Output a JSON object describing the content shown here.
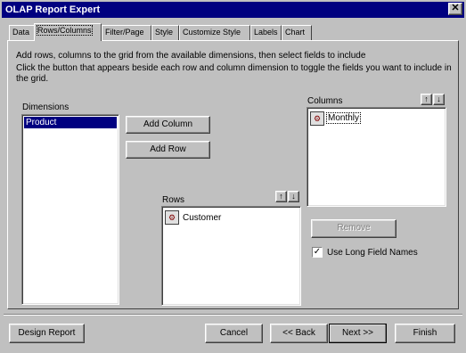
{
  "window": {
    "title": "OLAP Report Expert",
    "close_glyph": "✕"
  },
  "tabs": [
    {
      "label": "Data"
    },
    {
      "label": "Rows/Columns"
    },
    {
      "label": "Filter/Page"
    },
    {
      "label": "Style"
    },
    {
      "label": "Customize Style"
    },
    {
      "label": "Labels"
    },
    {
      "label": "Chart"
    }
  ],
  "instructions": {
    "line1": "Add rows, columns to the grid from the available dimensions, then select fields to include",
    "line2": "Click the button that appears beside each row and column dimension to toggle the fields you want to include in",
    "line3": "the grid."
  },
  "dimensions": {
    "label": "Dimensions",
    "items": [
      "Product"
    ]
  },
  "buttons": {
    "add_column": "Add Column",
    "add_row": "Add Row",
    "remove": "Remove",
    "design_report": "Design Report",
    "cancel": "Cancel",
    "back": "<< Back",
    "next": "Next >>",
    "finish": "Finish"
  },
  "columns": {
    "label": "Columns",
    "items": [
      "Monthly"
    ]
  },
  "rows": {
    "label": "Rows",
    "items": [
      "Customer"
    ]
  },
  "arrows": {
    "up": "↑",
    "down": "↓"
  },
  "use_long_field_names": {
    "label": "Use Long Field Names",
    "checked": true,
    "check_glyph": "✓"
  }
}
